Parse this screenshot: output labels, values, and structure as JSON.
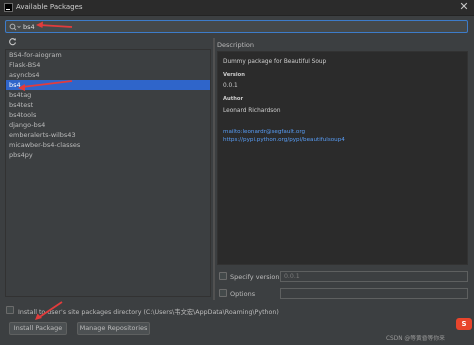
{
  "window": {
    "title": "Available Packages",
    "close_glyph": "✕"
  },
  "search": {
    "value": "bs4"
  },
  "packages": [
    "BS4-for-aiogram",
    "Flask-BS4",
    "asyncbs4",
    "bs4",
    "bs4tag",
    "bs4test",
    "bs4tools",
    "django-bs4",
    "emberalerts-wilbs43",
    "micawber-bs4-classes",
    "pbs4py"
  ],
  "selected_package": "bs4",
  "description": {
    "label": "Description",
    "summary": "Dummy package for Beautiful Soup",
    "version_heading": "Version",
    "version_value": "0.0.1",
    "author_heading": "Author",
    "author_value": "Leonard Richardson",
    "links": [
      "mailto:leonardr@segfault.org",
      "https://pypi.python.org/pypi/beautifulsoup4"
    ]
  },
  "options": {
    "specify_version_label": "Specify version",
    "version_field_value": "0.0.1",
    "options_label": "Options"
  },
  "install_to_user": {
    "label": "Install to user's site packages directory (C:\\Users\\韦文宏\\AppData\\Roaming\\Python)"
  },
  "buttons": {
    "install": "Install Package",
    "manage": "Manage Repositories"
  },
  "watermark": {
    "text": "CSDN @等黄昏等你来",
    "badge": "S"
  },
  "colors": {
    "accent": "#2f65ca",
    "focus": "#3d7cc9",
    "arrow": "#e23c3c",
    "link": "#589df6"
  },
  "icons": [
    "app-icon",
    "search-icon",
    "refresh-icon",
    "close-icon"
  ]
}
